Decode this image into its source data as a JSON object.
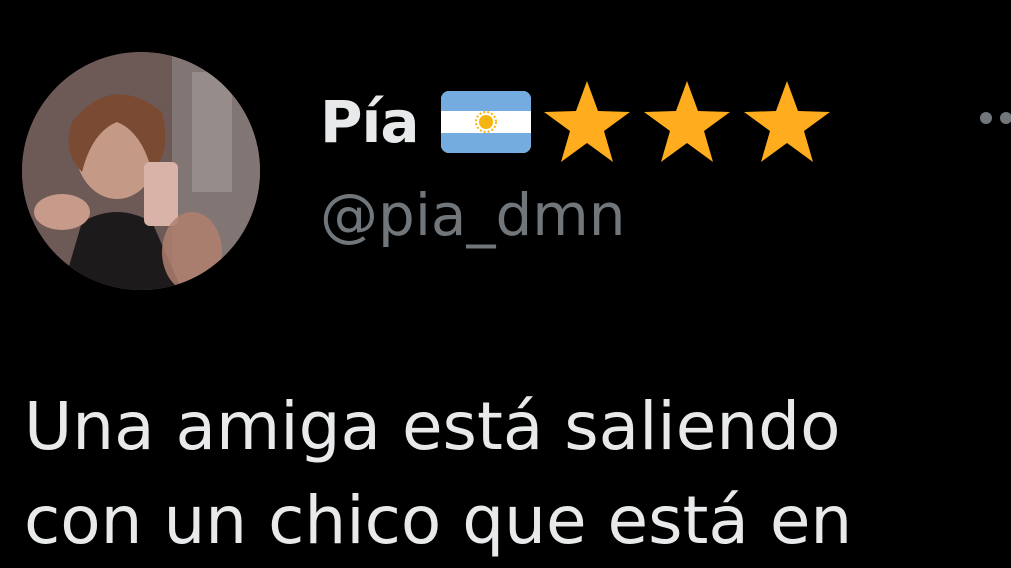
{
  "user": {
    "display_name": "Pía",
    "handle": "@pia_dmn",
    "flag_icon": "argentina-flag-icon",
    "star_icon": "star-icon",
    "star_count": 3,
    "star_color": "#ffad1f",
    "flag_blue": "#74acdf",
    "flag_sun": "#f6b40e"
  },
  "tweet": {
    "lines": [
      "Una amiga está saliendo",
      "con un chico que está en"
    ]
  },
  "colors": {
    "background": "#000000",
    "primary_text": "#e7e9ea",
    "secondary_text": "#71767b"
  },
  "more_icon": "more-options-icon"
}
